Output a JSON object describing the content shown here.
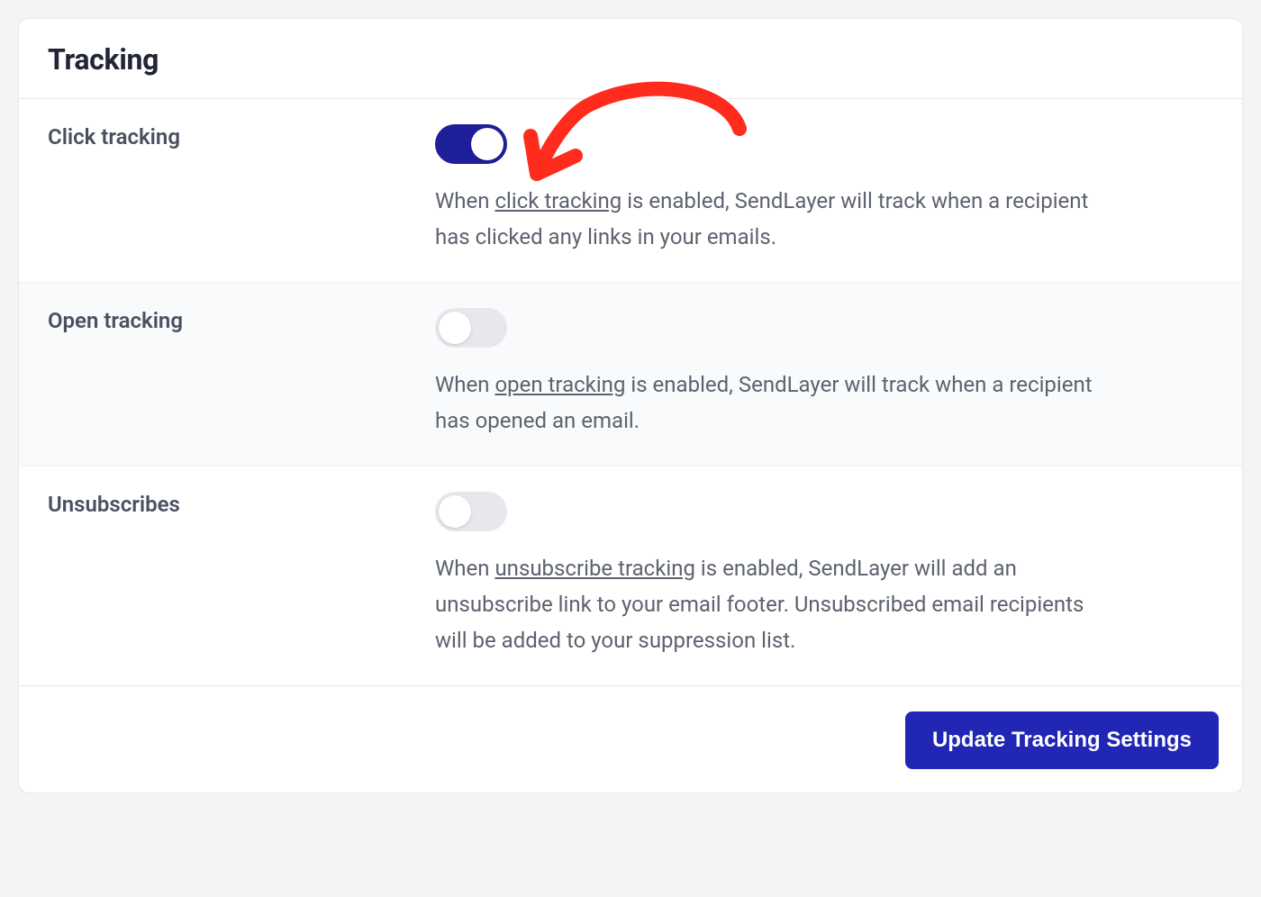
{
  "header": {
    "title": "Tracking"
  },
  "settings": [
    {
      "key": "click_tracking",
      "label": "Click tracking",
      "enabled": true,
      "desc_before": "When ",
      "desc_link": "click tracking",
      "desc_after": " is enabled, SendLayer will track when a recipient has clicked any links in your emails."
    },
    {
      "key": "open_tracking",
      "label": "Open tracking",
      "enabled": false,
      "desc_before": "When ",
      "desc_link": "open tracking",
      "desc_after": " is enabled, SendLayer will track when a recipient has opened an email."
    },
    {
      "key": "unsubscribes",
      "label": "Unsubscribes",
      "enabled": false,
      "desc_before": "When ",
      "desc_link": "unsubscribe tracking",
      "desc_after": " is enabled, SendLayer will add an unsubscribe link to your email footer. Unsubscribed email recipients will be added to your suppression list."
    }
  ],
  "footer": {
    "submit_label": "Update Tracking Settings"
  },
  "annotation": {
    "arrow_color": "#ff2b1c"
  }
}
